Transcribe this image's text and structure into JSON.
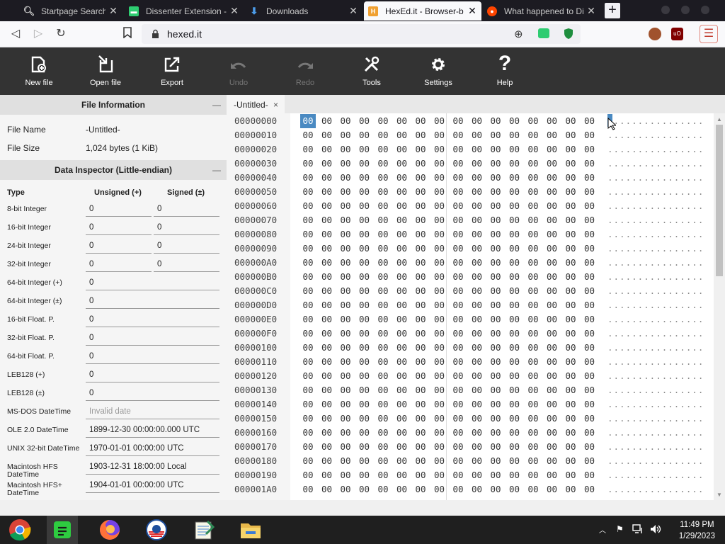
{
  "browser": {
    "tabs": [
      {
        "title": "Startpage Search Res",
        "icon": "search-icon",
        "active": false
      },
      {
        "title": "Dissenter Extension -",
        "icon": "dissenter-icon",
        "active": false
      },
      {
        "title": "Downloads",
        "icon": "download-icon",
        "active": false
      },
      {
        "title": "HexEd.it - Browser-b",
        "icon": "hexedit-icon",
        "active": true
      },
      {
        "title": "What happened to Di",
        "icon": "reddit-icon",
        "active": false
      }
    ],
    "url": "hexed.it"
  },
  "toolbar": {
    "new_file": "New file",
    "open_file": "Open file",
    "export": "Export",
    "undo": "Undo",
    "redo": "Redo",
    "tools": "Tools",
    "settings": "Settings",
    "help": "Help"
  },
  "file_info": {
    "title": "File Information",
    "collapse": "—",
    "name_label": "File Name",
    "name_value": "-Untitled-",
    "size_label": "File Size",
    "size_value": "1,024 bytes (1 KiB)"
  },
  "inspector": {
    "title": "Data Inspector (Little-endian)",
    "collapse": "—",
    "col_type": "Type",
    "col_unsigned": "Unsigned (+)",
    "col_signed": "Signed (±)",
    "rows_two": [
      {
        "type": "8-bit Integer",
        "unsigned": "0",
        "signed": "0"
      },
      {
        "type": "16-bit Integer",
        "unsigned": "0",
        "signed": "0"
      },
      {
        "type": "24-bit Integer",
        "unsigned": "0",
        "signed": "0"
      },
      {
        "type": "32-bit Integer",
        "unsigned": "0",
        "signed": "0"
      }
    ],
    "rows_one": [
      {
        "type": "64-bit Integer (+)",
        "value": "0"
      },
      {
        "type": "64-bit Integer (±)",
        "value": "0"
      },
      {
        "type": "16-bit Float. P.",
        "value": "0"
      },
      {
        "type": "32-bit Float. P.",
        "value": "0"
      },
      {
        "type": "64-bit Float. P.",
        "value": "0"
      },
      {
        "type": "LEB128 (+)",
        "value": "0"
      },
      {
        "type": "LEB128 (±)",
        "value": "0"
      },
      {
        "type": "MS-DOS DateTime",
        "value": "Invalid date",
        "placeholder": true
      },
      {
        "type": "OLE 2.0 DateTime",
        "value": "1899-12-30 00:00:00.000 UTC"
      },
      {
        "type": "UNIX 32-bit DateTime",
        "value": "1970-01-01 00:00:00 UTC"
      },
      {
        "type": "Macintosh HFS DateTime",
        "value": "1903-12-31 18:00:00 Local"
      },
      {
        "type": "Macintosh HFS+ DateTime",
        "value": "1904-01-01 00:00:00 UTC"
      }
    ]
  },
  "file_tab": {
    "title": "-Untitled-",
    "close": "×"
  },
  "hex": {
    "offsets": [
      "00000000",
      "00000010",
      "00000020",
      "00000030",
      "00000040",
      "00000050",
      "00000060",
      "00000070",
      "00000080",
      "00000090",
      "000000A0",
      "000000B0",
      "000000C0",
      "000000D0",
      "000000E0",
      "000000F0",
      "00000100",
      "00000110",
      "00000120",
      "00000130",
      "00000140",
      "00000150",
      "00000160",
      "00000170",
      "00000180",
      "00000190",
      "000001A0"
    ],
    "byte": "00",
    "ascii": "................",
    "selected_offset": "00000000"
  },
  "taskbar": {
    "apps": [
      "chrome-icon",
      "notes-icon",
      "firefox-icon",
      "obama-icon",
      "notepad-icon",
      "file-explorer-icon"
    ],
    "time": "11:49 PM",
    "date": "1/29/2023"
  },
  "colors": {
    "selection": "#4a8ac2",
    "toolbar": "#333333"
  }
}
